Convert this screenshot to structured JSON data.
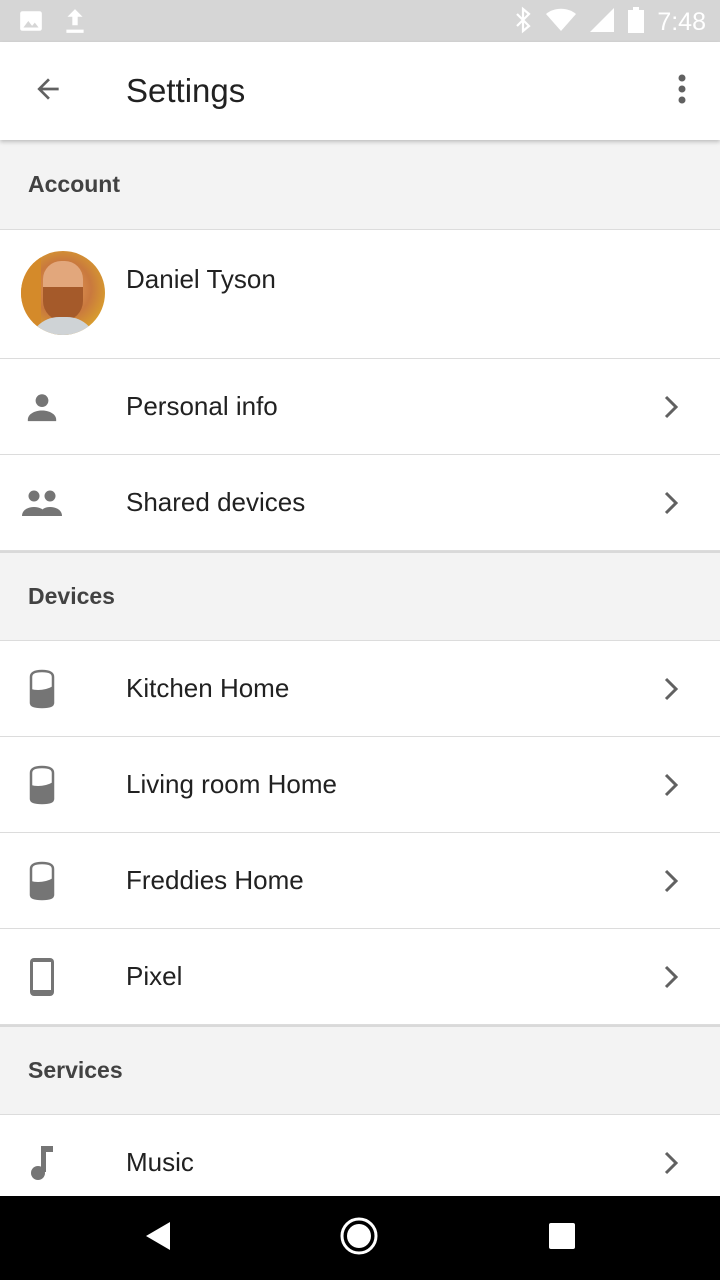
{
  "status_bar": {
    "time": "7:48",
    "left_icons": [
      "image-icon",
      "upload-icon"
    ],
    "right_icons": [
      "bluetooth-icon",
      "wifi-icon",
      "signal-icon",
      "battery-icon"
    ]
  },
  "app_bar": {
    "title": "Settings",
    "back_icon": "arrow-back-icon",
    "menu_icon": "more-vert-icon"
  },
  "sections": {
    "account": {
      "header": "Account",
      "profile_name": "Daniel Tyson",
      "items": [
        {
          "label": "Personal info",
          "icon": "person-icon"
        },
        {
          "label": "Shared devices",
          "icon": "people-icon"
        }
      ]
    },
    "devices": {
      "header": "Devices",
      "items": [
        {
          "label": "Kitchen Home",
          "icon": "google-home-icon"
        },
        {
          "label": "Living room Home",
          "icon": "google-home-icon"
        },
        {
          "label": "Freddies Home",
          "icon": "google-home-icon"
        },
        {
          "label": "Pixel",
          "icon": "phone-icon"
        }
      ]
    },
    "services": {
      "header": "Services",
      "items": [
        {
          "label": "Music",
          "icon": "music-note-icon"
        }
      ]
    }
  },
  "nav_bar": {
    "icons": [
      "back-triangle-icon",
      "home-circle-icon",
      "recents-square-icon"
    ]
  },
  "colors": {
    "status_bar": "#d6d6d6",
    "section_bg": "#f3f3f3",
    "icon_gray": "#757575",
    "text_primary": "#212121"
  }
}
